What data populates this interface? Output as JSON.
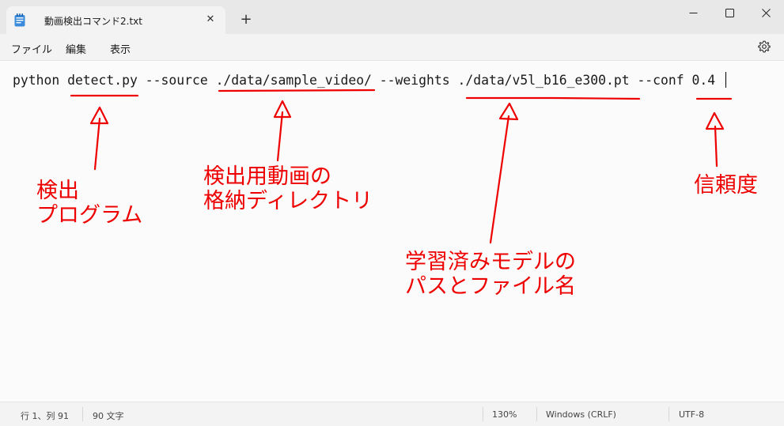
{
  "window": {
    "tab_title": "動画検出コマンド2.txt",
    "tab_close": "✕",
    "new_tab": "+"
  },
  "menu": {
    "file": "ファイル",
    "edit": "編集",
    "view": "表示"
  },
  "editor": {
    "line": "python detect.py --source ./data/sample_video/ --weights ./data/v5l_b16_e300.pt --conf 0.4"
  },
  "annotations": {
    "program": [
      "検出",
      "プログラム"
    ],
    "source_dir": [
      "検出用動画の",
      "格納ディレクトリ"
    ],
    "weights": [
      "学習済みモデルの",
      "パスとファイル名"
    ],
    "confidence": [
      "信頼度"
    ]
  },
  "annotation_color": "#ee0000",
  "status": {
    "position": "行 1、列 91",
    "chars": "90 文字",
    "zoom": "130%",
    "eol": "Windows (CRLF)",
    "encoding": "UTF-8"
  },
  "icons": {
    "tab": "notepad-icon",
    "settings": "gear-icon"
  }
}
